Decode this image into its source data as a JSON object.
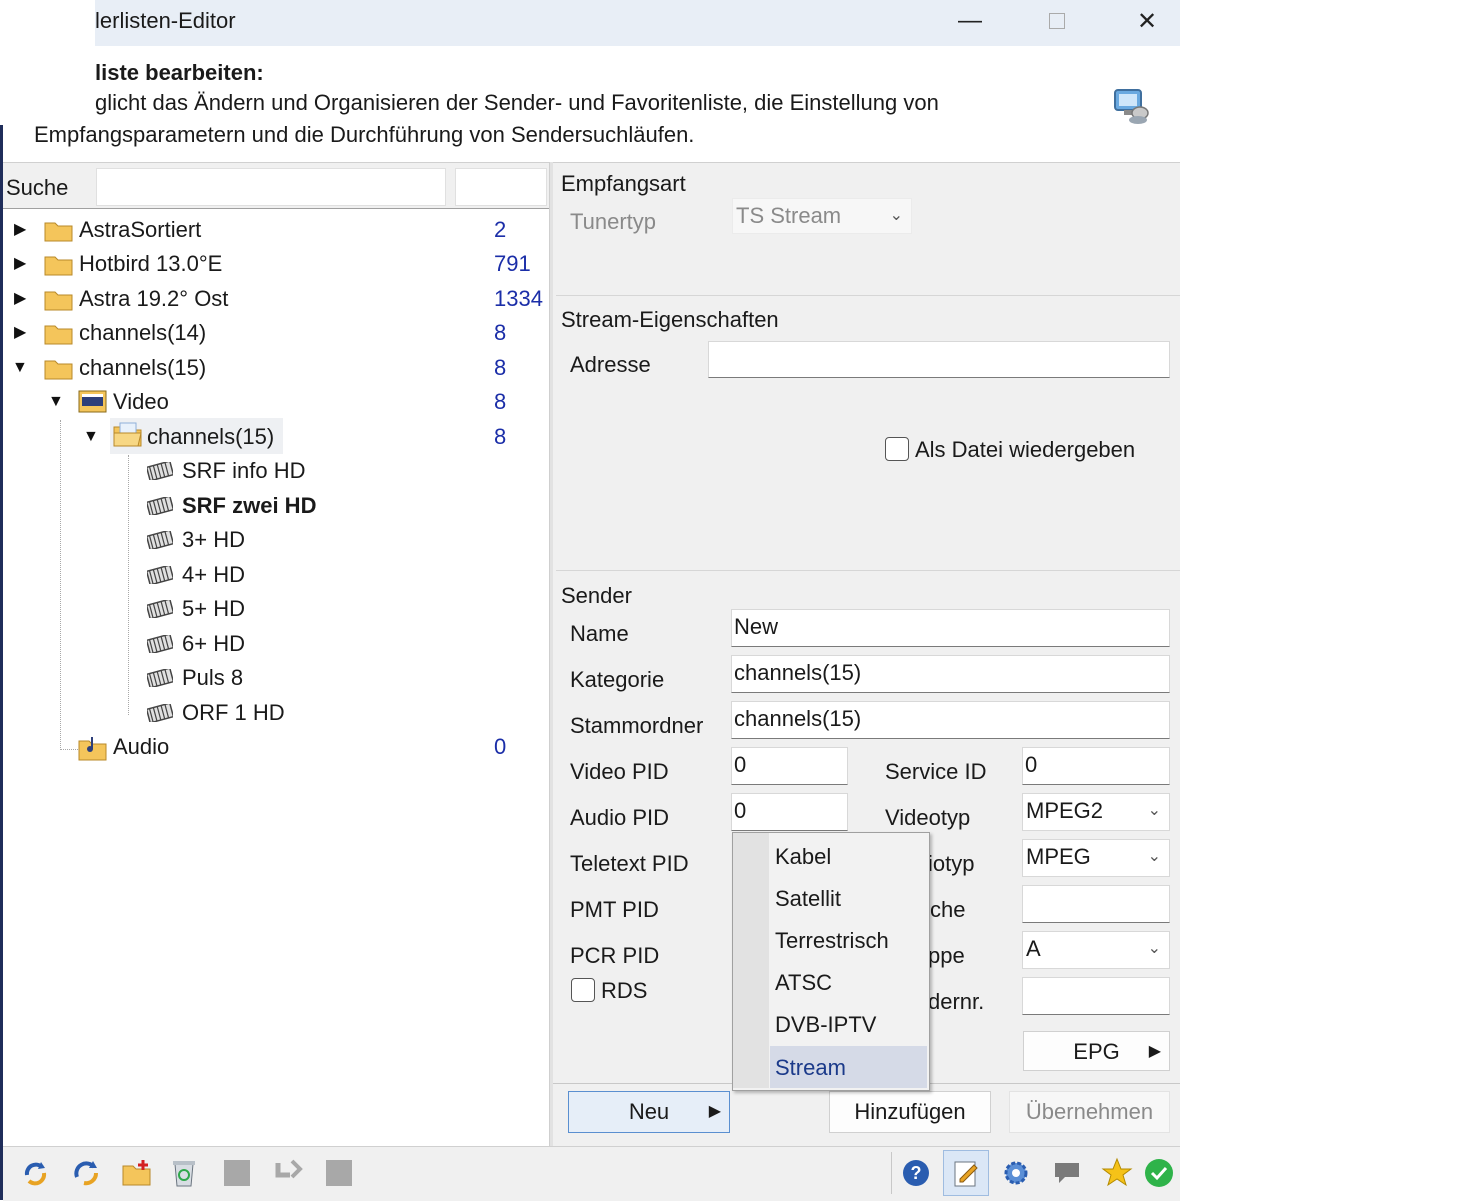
{
  "window": {
    "title": "lerlisten-Editor"
  },
  "header": {
    "title": "liste bearbeiten:",
    "desc_line1": "glicht das Ändern und Organisieren der Sender- und Favoritenliste, die Einstellung von",
    "desc_line2": "Empfangsparametern und die Durchführung von Sendersuchläufen."
  },
  "search": {
    "label": "Suche",
    "value": "",
    "placeholder": ""
  },
  "tree": {
    "items": [
      {
        "label": "AstraSortiert",
        "count": "2"
      },
      {
        "label": "Hotbird 13.0°E",
        "count": "791"
      },
      {
        "label": "Astra 19.2° Ost",
        "count": "1334"
      },
      {
        "label": "channels(14)",
        "count": "8"
      },
      {
        "label": "channels(15)",
        "count": "8"
      },
      {
        "label": "Video",
        "count": "8"
      },
      {
        "label": "channels(15)",
        "count": "8"
      },
      {
        "label": "SRF info HD"
      },
      {
        "label": "SRF zwei HD"
      },
      {
        "label": "3+ HD"
      },
      {
        "label": "4+ HD"
      },
      {
        "label": "5+ HD"
      },
      {
        "label": "6+ HD"
      },
      {
        "label": "Puls 8"
      },
      {
        "label": "ORF 1 HD"
      },
      {
        "label": "Audio",
        "count": "0"
      }
    ]
  },
  "empfang": {
    "group": "Empfangsart",
    "tunertyp_label": "Tunertyp",
    "tunertyp_value": "TS Stream"
  },
  "stream": {
    "group": "Stream-Eigenschaften",
    "adresse_label": "Adresse",
    "adresse_value": "",
    "als_datei_label": "Als Datei wiedergeben"
  },
  "sender": {
    "group": "Sender",
    "name_label": "Name",
    "name_value": "New",
    "kategorie_label": "Kategorie",
    "kategorie_value": "channels(15)",
    "stammordner_label": "Stammordner",
    "stammordner_value": "channels(15)",
    "video_pid_label": "Video PID",
    "video_pid_value": "0",
    "audio_pid_label": "Audio PID",
    "audio_pid_value": "0",
    "teletext_pid_label": "Teletext PID",
    "pmt_pid_label": "PMT PID",
    "pcr_pid_label": "PCR PID",
    "rds_label": "RDS",
    "service_id_label": "Service ID",
    "service_id_value": "0",
    "videotyp_label": "Videotyp",
    "videotyp_value": "MPEG2",
    "audiotyp_label_partial": "iotyp",
    "audiotyp_value": "MPEG",
    "sprache_label_partial": "che",
    "sprache_value": "",
    "gruppe_label_partial": "ppe",
    "gruppe_value": "A",
    "sendernr_label_partial": "dernr.",
    "sendernr_value": "",
    "epg_label": "EPG"
  },
  "buttons": {
    "neu": "Neu",
    "hinzufuegen": "Hinzufügen",
    "uebernehmen": "Übernehmen"
  },
  "menu": {
    "items": [
      "Kabel",
      "Satellit",
      "Terrestrisch",
      "ATSC",
      "DVB-IPTV",
      "Stream"
    ],
    "highlighted": "Stream"
  },
  "colors": {
    "count": "#1b2ea8",
    "titlebar": "#e8eef6",
    "menu_highlight": "#d5dae7",
    "ok_green": "#2fb34a"
  }
}
